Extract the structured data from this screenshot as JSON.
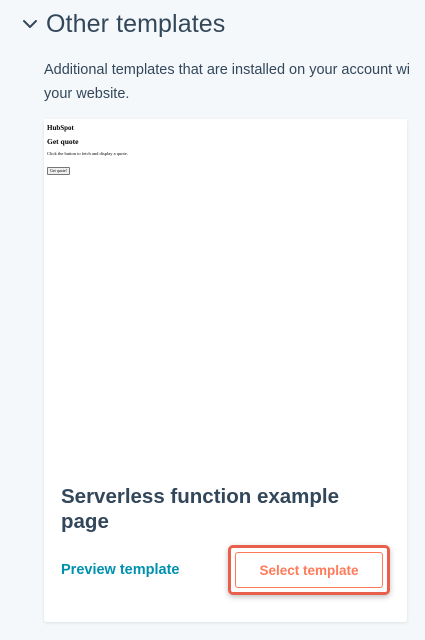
{
  "section": {
    "title": "Other templates",
    "description_line1": "Additional templates that are installed on your account wi",
    "description_line2": "your website.",
    "icon": "chevron-down-icon"
  },
  "template_card": {
    "preview": {
      "brand": "HubSpot",
      "heading": "Get quote",
      "text": "Click the button to fetch and display a quote.",
      "button_label": "Get quote!"
    },
    "title": "Serverless function example page",
    "preview_link_label": "Preview template",
    "select_button_label": "Select template"
  },
  "colors": {
    "link": "#0091ae",
    "accent": "#ff7a59",
    "highlight": "#e8604c",
    "text": "#33475b",
    "background": "#f5f8fa"
  }
}
